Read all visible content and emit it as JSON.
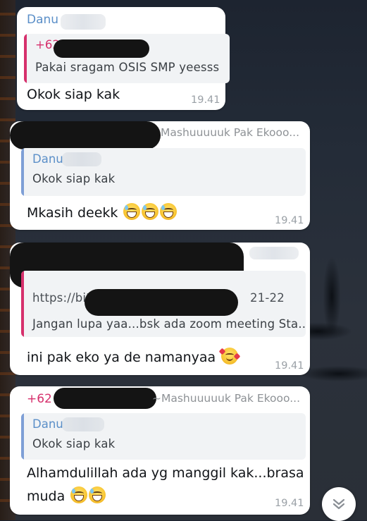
{
  "messages": [
    {
      "sender": "Danu",
      "quote": {
        "name": "+62",
        "text": "Pakai sragam OSIS SMP yeesss"
      },
      "text": "Okok siap kak",
      "time": "19.41"
    },
    {
      "sender_right": "Mashuuuuuk Pak Ekooo...",
      "quote": {
        "name": "Danu",
        "text": "Okok siap kak"
      },
      "text": "Mkasih deekk",
      "emojis": [
        "grin-sweat",
        "grin-sweat",
        "grin-sweat"
      ],
      "time": "19.41"
    },
    {
      "quote": {
        "link_start": "https://bit",
        "link_end": "21-22",
        "text": "Jangan lupa yaa...bsk ada zoom meeting Sta..."
      },
      "text": "ini pak eko ya de namanyaa",
      "emojis": [
        "hearts"
      ],
      "time": "19.41"
    },
    {
      "sender": "+62",
      "sender_right": "~Mashuuuuuk Pak Ekooo...",
      "quote": {
        "name": "Danu",
        "text": "Okok siap kak"
      },
      "text_line1": "Alhamdulillah ada yg manggil kak...brasa",
      "text_line2": "muda",
      "emojis": [
        "grin-sweat",
        "grin-sweat"
      ],
      "time": "19.41"
    }
  ],
  "scroll_button": {
    "icon": "double-chevron-down-icon"
  },
  "colors": {
    "bubble": "#ffffff",
    "sender_blue": "#5b8fc8",
    "sender_pink": "#d6306c",
    "quote_bg": "#f1f3f5",
    "time": "#9aa0a6"
  }
}
